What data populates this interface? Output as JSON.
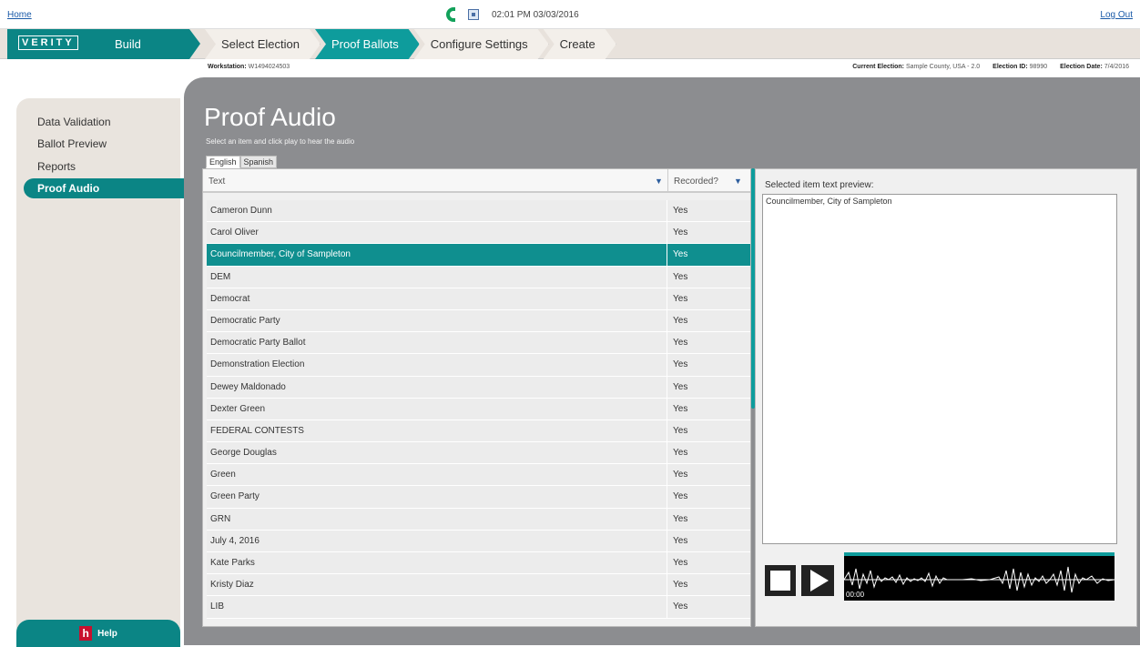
{
  "topbar": {
    "home": "Home",
    "logout": "Log Out",
    "datetime": "02:01 PM 03/03/2016"
  },
  "brand": {
    "logo": "VERITY",
    "section": "Build"
  },
  "steps": [
    "Select Election",
    "Proof Ballots",
    "Configure Settings",
    "Create"
  ],
  "active_step": "Proof Ballots",
  "info": {
    "workstation_label": "Workstation:",
    "workstation": "W1494024503",
    "election_label": "Current Election:",
    "election": "Sample County, USA - 2.0",
    "id_label": "Election ID:",
    "id": "98990",
    "date_label": "Election Date:",
    "date": "7/4/2016"
  },
  "sidebar": {
    "items": [
      "Data Validation",
      "Ballot Preview",
      "Reports"
    ],
    "active": "Proof Audio",
    "help": "Help"
  },
  "main": {
    "title": "Proof Audio",
    "subtitle": "Select an item and click play to hear the audio",
    "tabs": [
      "English",
      "Spanish"
    ],
    "columns": [
      "Text",
      "Recorded?"
    ],
    "rows": [
      {
        "text": "Cameron Dunn",
        "recorded": "Yes"
      },
      {
        "text": "Carol Oliver",
        "recorded": "Yes"
      },
      {
        "text": "Councilmember, City of Sampleton",
        "recorded": "Yes"
      },
      {
        "text": "DEM",
        "recorded": "Yes"
      },
      {
        "text": "Democrat",
        "recorded": "Yes"
      },
      {
        "text": "Democratic Party",
        "recorded": "Yes"
      },
      {
        "text": "Democratic Party Ballot",
        "recorded": "Yes"
      },
      {
        "text": "Demonstration Election",
        "recorded": "Yes"
      },
      {
        "text": "Dewey Maldonado",
        "recorded": "Yes"
      },
      {
        "text": "Dexter Green",
        "recorded": "Yes"
      },
      {
        "text": "FEDERAL CONTESTS",
        "recorded": "Yes"
      },
      {
        "text": "George Douglas",
        "recorded": "Yes"
      },
      {
        "text": "Green",
        "recorded": "Yes"
      },
      {
        "text": "Green Party",
        "recorded": "Yes"
      },
      {
        "text": "GRN",
        "recorded": "Yes"
      },
      {
        "text": "July 4, 2016",
        "recorded": "Yes"
      },
      {
        "text": "Kate Parks",
        "recorded": "Yes"
      },
      {
        "text": "Kristy Diaz",
        "recorded": "Yes"
      },
      {
        "text": "LIB",
        "recorded": "Yes"
      }
    ],
    "selected_index": 2,
    "preview_label": "Selected item text preview:",
    "preview_text": "Councilmember, City of Sampleton",
    "audio_time": "00:00"
  },
  "colors": {
    "accent": "#0b8585",
    "accent_light": "#0e9c9c",
    "panel": "#8c8d90"
  }
}
